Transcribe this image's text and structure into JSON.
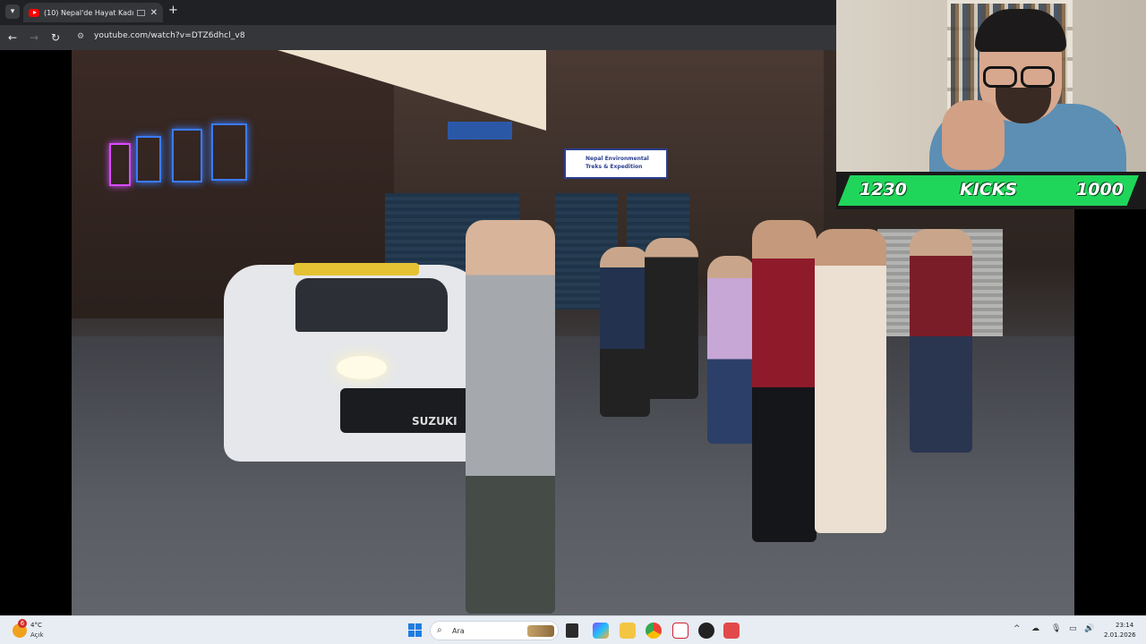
{
  "browser": {
    "tab_title": "(10) Nepal'de Hayat Kadınl...",
    "tab_close": "✕",
    "new_tab": "+",
    "url": "youtube.com/watch?v=DTZ6dhcl_v8"
  },
  "video": {
    "shop_sign_line1": "Nepal Environmental",
    "shop_sign_line2": "Treks & Expedition",
    "car_label": "SUZUKI"
  },
  "overlay": {
    "left_count": "1230",
    "label": "KICKS",
    "right_count": "1000"
  },
  "taskbar": {
    "weather_badge": "6",
    "temperature": "4°C",
    "condition": "Açık",
    "search_placeholder": "Ara",
    "time": "23:14",
    "date": "2.01.2026"
  },
  "colors": {
    "accent_green": "#1fd65a",
    "youtube_red": "#ff0000",
    "windows_blue": "#1e7de0"
  }
}
